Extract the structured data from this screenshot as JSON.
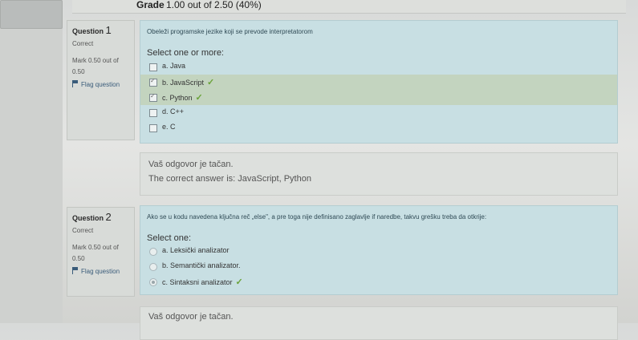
{
  "grade": {
    "label": "Grade",
    "value": "1.00 out of 2.50 (40%)"
  },
  "questions": [
    {
      "title": "Question",
      "number": "1",
      "state": "Correct",
      "mark": "Mark 0.50 out of 0.50",
      "flag": "Flag question",
      "text": "Obeleži programske jezike koji se prevode interpretatorom",
      "prompt": "Select one or more:",
      "answers": [
        {
          "label": "a. Java",
          "checked": false,
          "correct": false
        },
        {
          "label": "b. JavaScript",
          "checked": true,
          "correct": true
        },
        {
          "label": "c. Python",
          "checked": true,
          "correct": true
        },
        {
          "label": "d. C++",
          "checked": false,
          "correct": false
        },
        {
          "label": "e. C",
          "checked": false,
          "correct": false
        }
      ],
      "feedback": "Vaš odgovor je tačan.",
      "correct_answer": "The correct answer is: JavaScript, Python"
    },
    {
      "title": "Question",
      "number": "2",
      "state": "Correct",
      "mark": "Mark 0.50 out of 0.50",
      "flag": "Flag question",
      "text": "Ako se u kodu navedena ključna reč „else\", a pre toga nije definisano zaglavlje if naredbe, takvu grešku treba da otkrije:",
      "prompt": "Select one:",
      "answers": [
        {
          "label": "a. Leksički analizator",
          "checked": false,
          "correct": false
        },
        {
          "label": "b. Semantički analizator.",
          "checked": false,
          "correct": false
        },
        {
          "label": "c. Sintaksni analizator",
          "checked": true,
          "correct": true
        }
      ],
      "feedback": "Vaš odgovor je tačan."
    }
  ],
  "colors": {
    "content_bg": "#c8dfe3",
    "selected_bg": "#c3d4bf",
    "tick": "#6aa33a"
  },
  "icons": {
    "flag": "flag-icon",
    "tick": "check-icon"
  }
}
